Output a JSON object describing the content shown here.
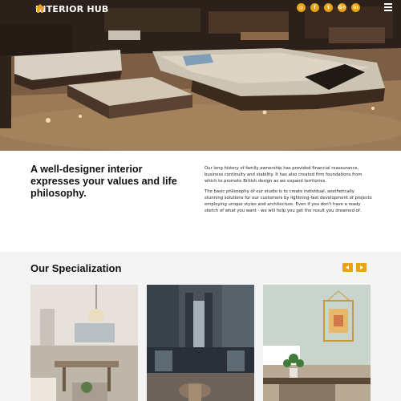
{
  "header": {
    "brand": "INTERIOR HUB",
    "logo_icon": "home-icon",
    "social": [
      {
        "name": "rss",
        "glyph": "◎"
      },
      {
        "name": "facebook",
        "glyph": "f"
      },
      {
        "name": "twitter",
        "glyph": "t"
      },
      {
        "name": "google-plus",
        "glyph": "G+"
      },
      {
        "name": "linkedin",
        "glyph": "in"
      }
    ],
    "menu_icon": "hamburger-menu-icon"
  },
  "intro": {
    "heading": "A well-designer interior expresses your values and life philosophy.",
    "paragraph_1": "Our long history of family ownership has provided financial reassurance, business continuity and stability. It has also created firm foundations from which to promote British design as we expand territories.",
    "paragraph_2": "The basic philosophy of our studio is to create individual, aesthetically stunning solutions for our customers by lightning-fast development of projects employing unique styles and architecture. Even if you don't have a ready sketch of what you want - we will help you get the result you dreamed of."
  },
  "specialization": {
    "title": "Our Specialization",
    "prev_icon": "chevron-left-icon",
    "next_icon": "chevron-right-icon"
  },
  "colors": {
    "accent": "#e8a317",
    "section_bg": "#f4f4f4",
    "text": "#111111"
  }
}
